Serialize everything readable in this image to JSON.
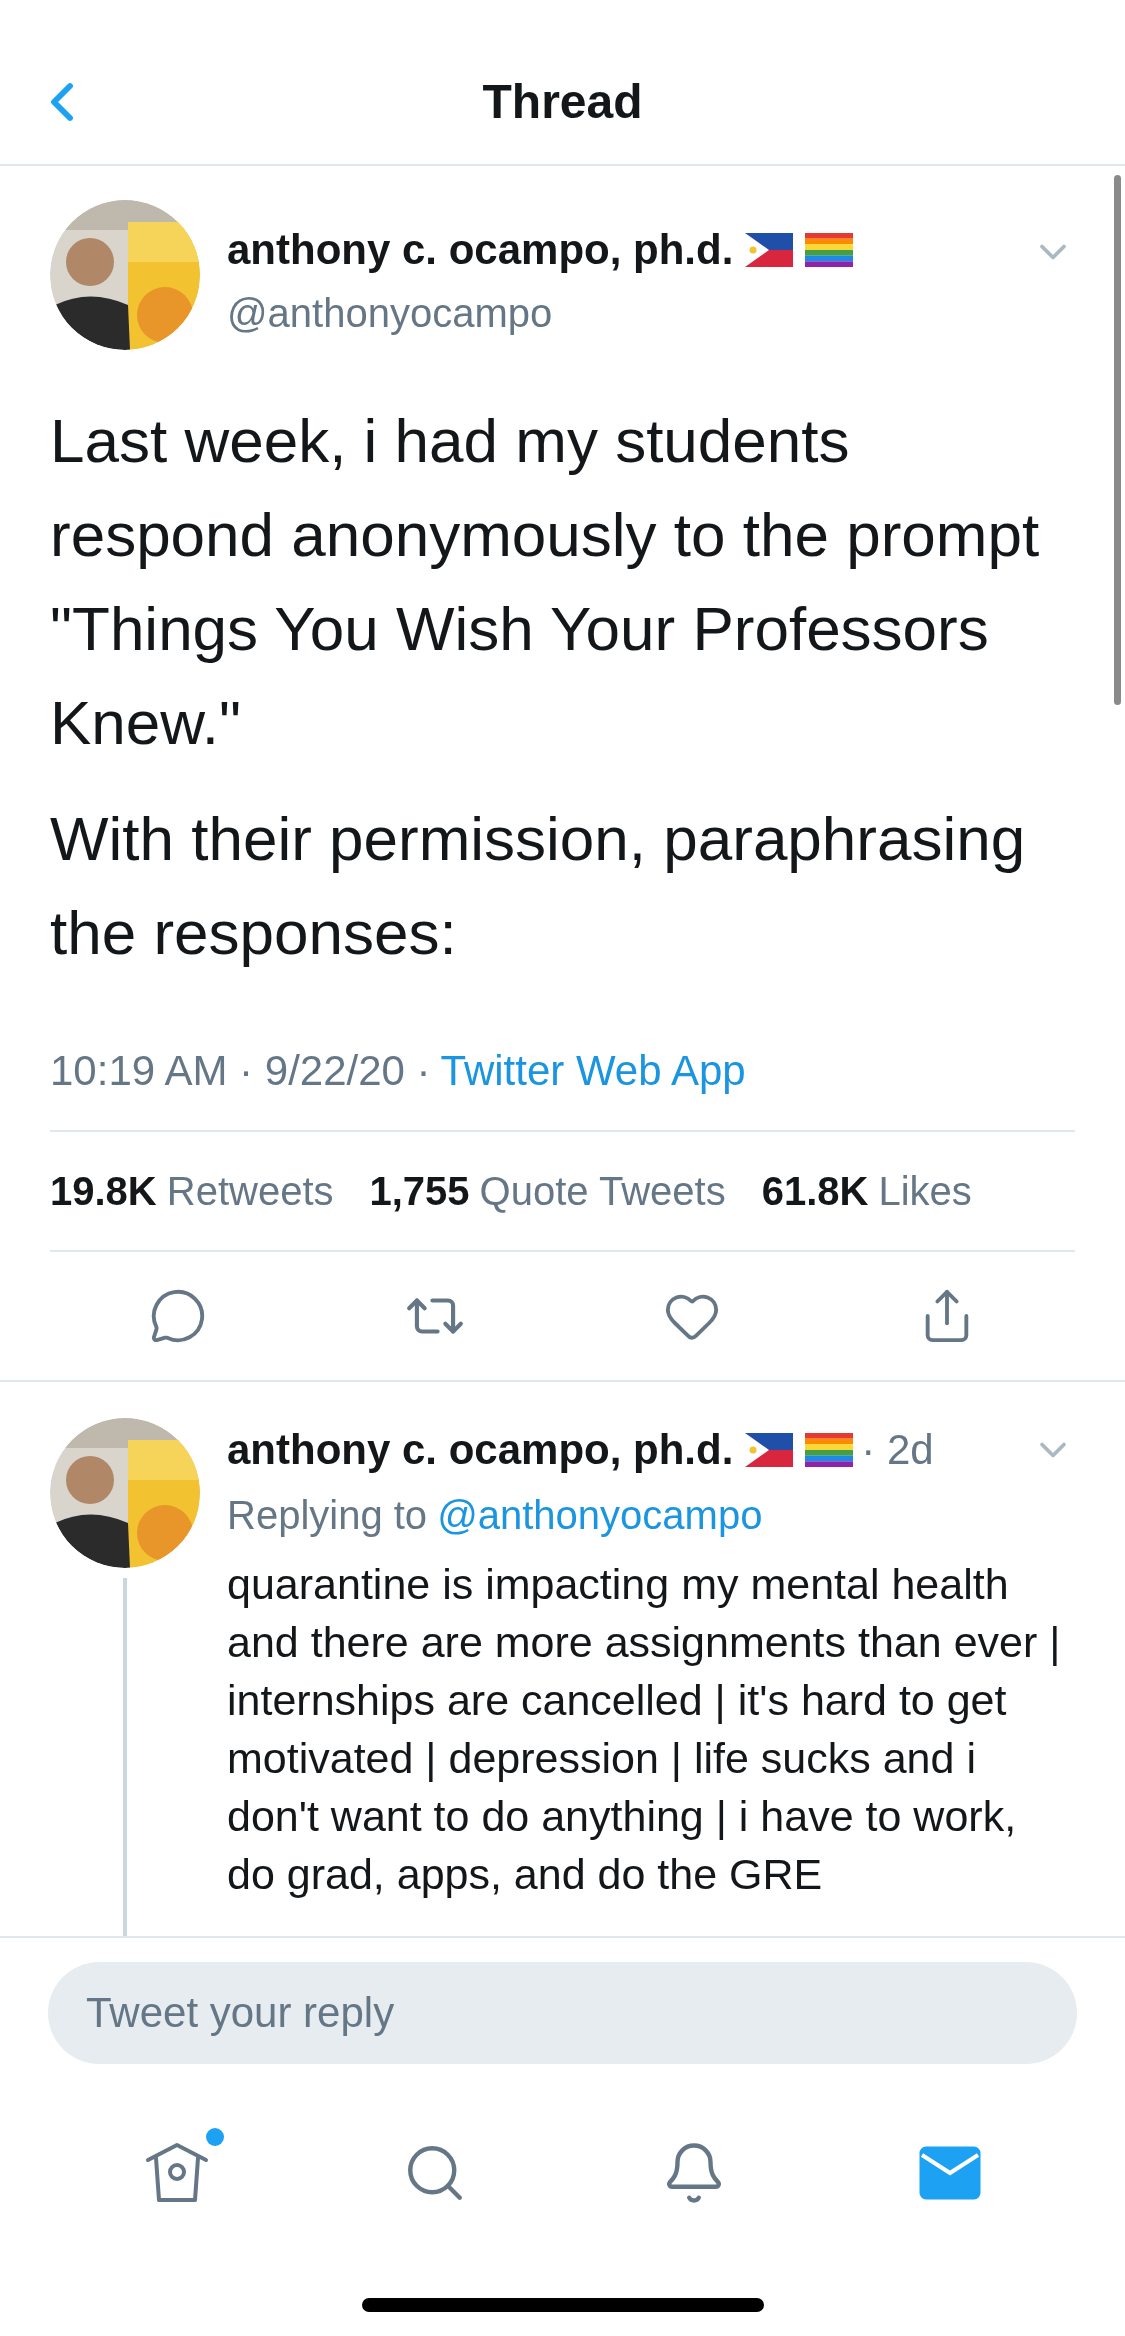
{
  "header": {
    "title": "Thread"
  },
  "tweet": {
    "name": "anthony c. ocampo, ph.d.",
    "handle": "@anthonyocampo",
    "paragraphs": [
      "Last week, i had my students respond anonymously to the prompt \"Things You Wish Your Professors Knew.\"",
      "With their permission, paraphrasing the responses:"
    ],
    "time": "10:19 AM · 9/22/20 ·",
    "source": "Twitter Web App",
    "stats": [
      {
        "count": "19.8K",
        "label": "Retweets"
      },
      {
        "count": "1,755",
        "label": "Quote Tweets"
      },
      {
        "count": "61.8K",
        "label": "Likes"
      }
    ]
  },
  "reply": {
    "name": "anthony c. ocampo, ph.d.",
    "age": "· 2d",
    "replying_label": "Replying to",
    "replying_to": "@anthonyocampo",
    "text": "quarantine is impacting my mental health and there are more assignments than ever | internships are cancelled | it's hard to get motivated | depression | life sucks and i don't want to do anything | i have to work, do grad, apps, and do the GRE"
  },
  "composer": {
    "placeholder": "Tweet your reply"
  },
  "tab_bar": {
    "tabs": [
      {
        "kind": "home",
        "selected": false,
        "badge": true
      },
      {
        "kind": "search",
        "selected": false,
        "badge": false
      },
      {
        "kind": "notifications",
        "selected": false,
        "badge": false
      },
      {
        "kind": "messages",
        "selected": true,
        "badge": false
      }
    ]
  }
}
